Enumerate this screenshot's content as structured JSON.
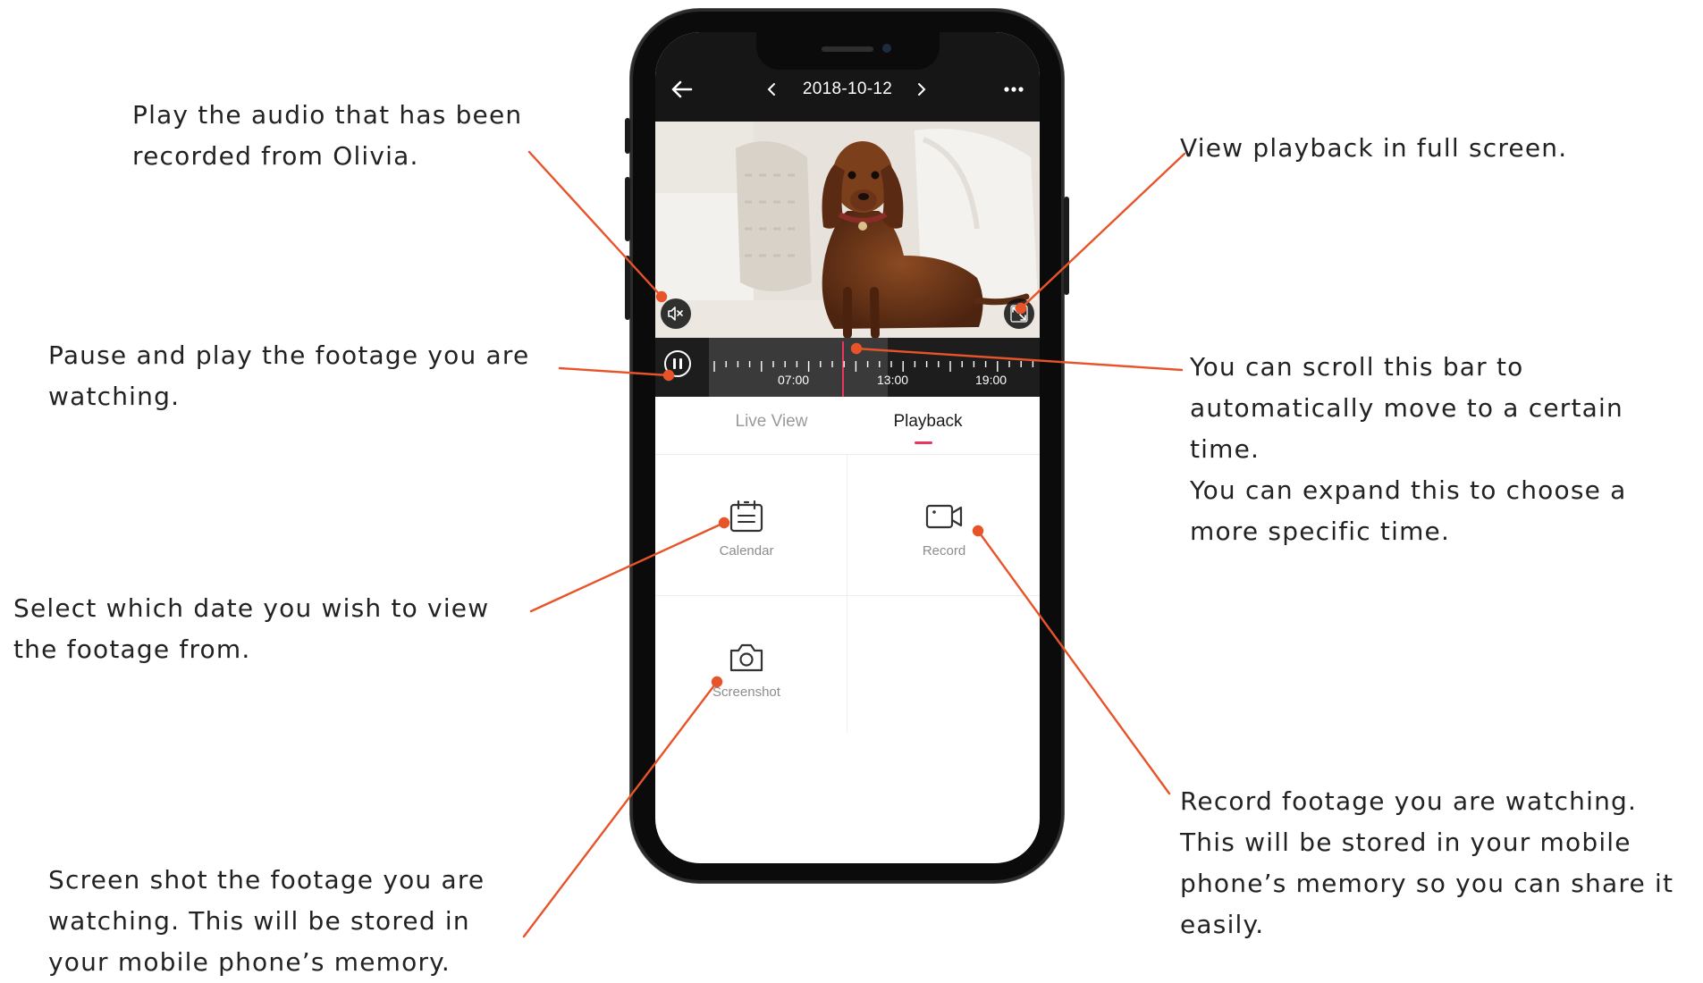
{
  "annotations": {
    "audio": [
      "Play the audio that has been",
      "recorded from Olivia."
    ],
    "pause": [
      "Pause and play the footage you are",
      "watching."
    ],
    "calendar": [
      "Select which date you wish to view",
      "the footage from."
    ],
    "screenshot": [
      "Screen shot the footage you are",
      "watching. This will be stored in",
      "your mobile phone’s memory."
    ],
    "fullscreen": [
      "View playback in full screen."
    ],
    "timeline": [
      "You can scroll this bar to",
      "automatically move to a certain",
      "time.",
      "You can expand this to choose a",
      "more specific time."
    ],
    "record": [
      "Record footage you are watching.",
      "This will be stored in your mobile",
      "phone’s memory so you can share it",
      "easily."
    ]
  },
  "colors": {
    "leader": "#e8542a",
    "accent": "#e8365d",
    "topbar": "#161616"
  },
  "app": {
    "date": "2018-10-12",
    "back_icon": "arrow-left-icon",
    "prev_icon": "chevron-left-icon",
    "next_icon": "chevron-right-icon",
    "more_icon": "more-horizontal-icon",
    "mute_icon": "speaker-muted-icon",
    "fullscreen_icon": "fullscreen-icon",
    "pause_icon": "pause-icon",
    "timeline_labels": [
      "07:00",
      "13:00",
      "19:00"
    ],
    "tabs": {
      "live": "Live View",
      "playback": "Playback",
      "active": "playback"
    },
    "tools": {
      "calendar": "Calendar",
      "record": "Record",
      "screenshot": "Screenshot"
    }
  }
}
